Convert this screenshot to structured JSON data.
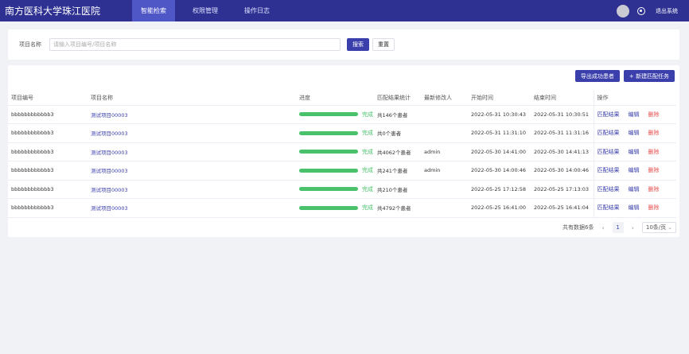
{
  "header": {
    "brand": "南方医科大学珠江医院",
    "nav": [
      "智能检索",
      "权限管理",
      "操作日志"
    ],
    "logout": "退出系统"
  },
  "search": {
    "label": "项目名称",
    "placeholder": "请输入项目编号/项目名称",
    "search_btn": "搜索",
    "reset_btn": "重置"
  },
  "actions": {
    "export_btn": "导出成功患者",
    "new_btn": "+ 新建匹配任务"
  },
  "table": {
    "columns": [
      "项目编号",
      "项目名称",
      "进度",
      "匹配结果统计",
      "最新修改人",
      "开始时间",
      "结束时间",
      "操作"
    ],
    "rows": [
      {
        "id": "bbbbbbbbbbbb3",
        "name": "测试项目00003",
        "progress_pct": 100,
        "progress_label": "完成",
        "result": "共146个患者",
        "modifier": "",
        "start": "2022-05-31 10:30:43",
        "end": "2022-05-31 10:30:51"
      },
      {
        "id": "bbbbbbbbbbbb3",
        "name": "测试项目00003",
        "progress_pct": 100,
        "progress_label": "完成",
        "result": "共0个患者",
        "modifier": "",
        "start": "2022-05-31 11:31:10",
        "end": "2022-05-31 11:31:16"
      },
      {
        "id": "bbbbbbbbbbbb3",
        "name": "测试项目00003",
        "progress_pct": 100,
        "progress_label": "完成",
        "result": "共4062个患者",
        "modifier": "admin",
        "start": "2022-05-30 14:41:00",
        "end": "2022-05-30 14:41:13"
      },
      {
        "id": "bbbbbbbbbbbb3",
        "name": "测试项目00003",
        "progress_pct": 100,
        "progress_label": "完成",
        "result": "共241个患者",
        "modifier": "admin",
        "start": "2022-05-30 14:00:46",
        "end": "2022-05-30 14:00:46"
      },
      {
        "id": "bbbbbbbbbbbb3",
        "name": "测试项目00003",
        "progress_pct": 100,
        "progress_label": "完成",
        "result": "共210个患者",
        "modifier": "",
        "start": "2022-05-25 17:12:58",
        "end": "2022-05-25 17:13:03"
      },
      {
        "id": "bbbbbbbbbbbb3",
        "name": "测试项目00003",
        "progress_pct": 100,
        "progress_label": "完成",
        "result": "共4792个患者",
        "modifier": "",
        "start": "2022-05-25 16:41:00",
        "end": "2022-05-25 16:41:04"
      }
    ],
    "ops": [
      "匹配结果",
      "编辑",
      "删除"
    ]
  },
  "pager": {
    "total": "共有数据6条",
    "current": "1",
    "size": "10条/页"
  },
  "colors": {
    "header_bg": "#2e3192",
    "accent": "#3a3fab",
    "success": "#4ac26b",
    "danger": "#e64d4d"
  }
}
